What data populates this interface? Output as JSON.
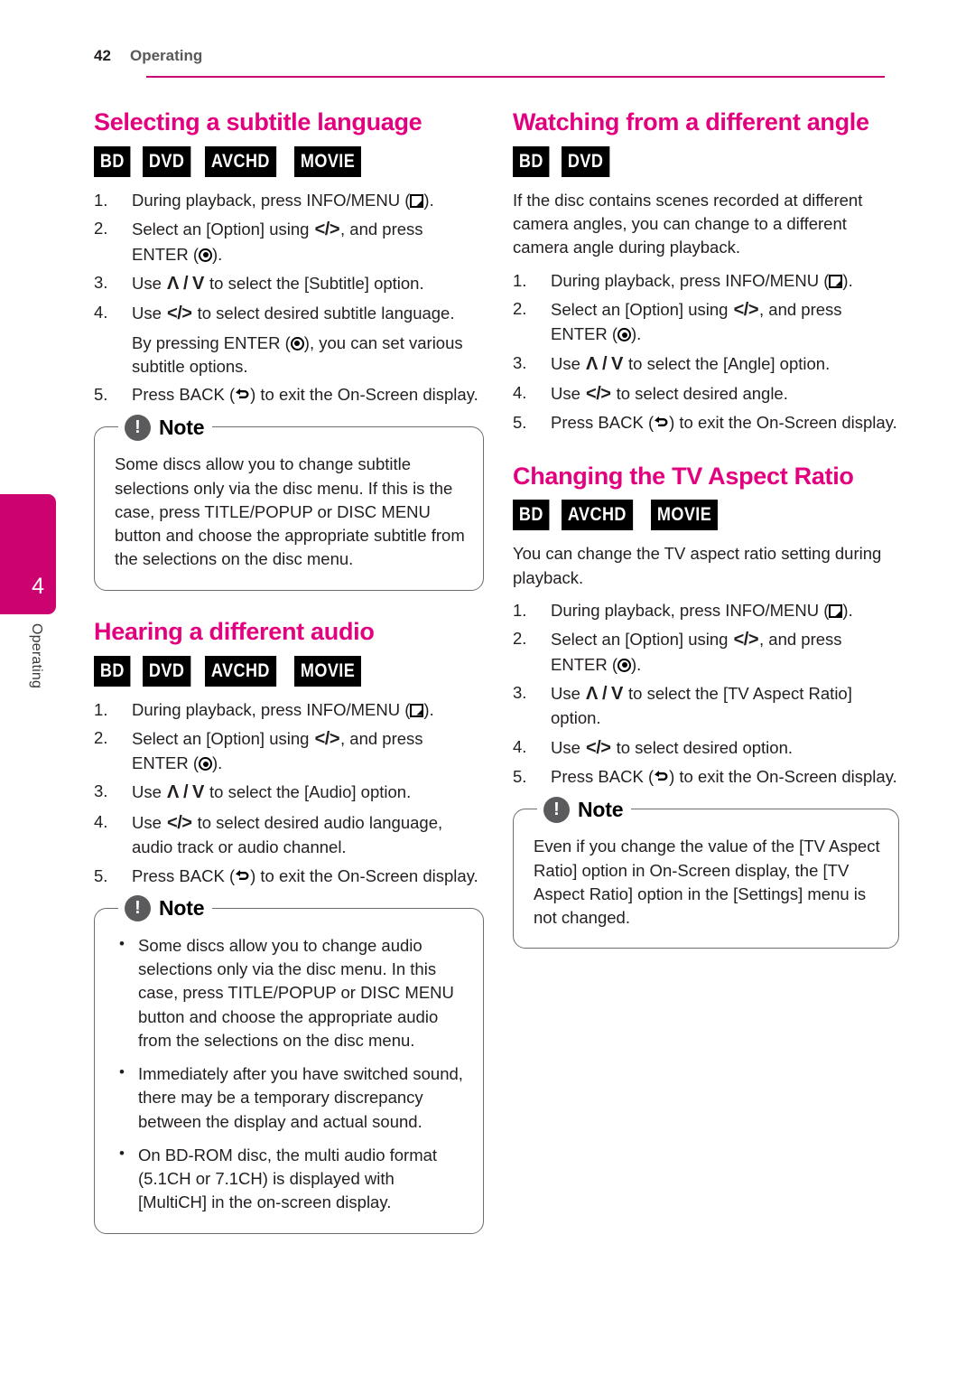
{
  "header": {
    "page_number": "42",
    "chapter_name": "Operating",
    "rule_color": "#cc0271"
  },
  "side_tab": {
    "number": "4",
    "label": "Operating",
    "color": "#cc0271"
  },
  "icons": {
    "info_menu": "info-menu-icon",
    "enter": "enter-icon",
    "back": "back-icon",
    "left_right": "</>",
    "up_down": "Λ / V",
    "note_bang": "!"
  },
  "left_column": {
    "sections": [
      {
        "title": "Selecting a subtitle language",
        "badges": [
          "BD",
          "DVD",
          "AVCHD",
          "MOVIE"
        ],
        "steps": [
          {
            "marker": "1.",
            "pre": "During playback, press INFO/MENU (",
            "glyph": "info",
            "post": ")."
          },
          {
            "marker": "2.",
            "pre": "Select an [Option] using ",
            "glyph": "lr",
            "mid": ", and press ENTER (",
            "glyph2": "enter",
            "post": ")."
          },
          {
            "marker": "3.",
            "pre": "Use ",
            "glyph": "ud",
            "post": " to select the [Subtitle] option."
          },
          {
            "marker": "4.",
            "pre": "Use ",
            "glyph": "lr",
            "post": " to select desired subtitle language.",
            "sub_pre": "By pressing ENTER (",
            "sub_glyph": "enter",
            "sub_post": "), you can set various subtitle options."
          },
          {
            "marker": "5.",
            "pre": "Press BACK (",
            "glyph": "back",
            "post": ") to exit the On-Screen display."
          }
        ],
        "note": {
          "title": "Note",
          "paragraph": "Some discs allow you to change subtitle selections only via the disc menu. If this is the case, press TITLE/POPUP or DISC MENU button and choose the appropriate subtitle from the selections on the disc menu."
        }
      },
      {
        "title": "Hearing a different audio",
        "badges": [
          "BD",
          "DVD",
          "AVCHD",
          "MOVIE"
        ],
        "steps": [
          {
            "marker": "1.",
            "pre": "During playback, press INFO/MENU (",
            "glyph": "info",
            "post": ")."
          },
          {
            "marker": "2.",
            "pre": "Select an [Option] using ",
            "glyph": "lr",
            "mid": ", and press ENTER (",
            "glyph2": "enter",
            "post": ")."
          },
          {
            "marker": "3.",
            "pre": "Use ",
            "glyph": "ud",
            "post": " to select the [Audio] option."
          },
          {
            "marker": "4.",
            "pre": "Use ",
            "glyph": "lr",
            "post": " to select desired audio language, audio track or audio channel."
          },
          {
            "marker": "5.",
            "pre": "Press BACK (",
            "glyph": "back",
            "post": ") to exit the On-Screen display."
          }
        ],
        "note": {
          "title": "Note",
          "bullets": [
            "Some discs allow you to change audio selections only via the disc menu. In this case, press TITLE/POPUP or DISC MENU button and choose the appropriate audio from the selections on the disc menu.",
            "Immediately after you have switched sound, there may be a temporary discrepancy between the display and actual sound.",
            "On BD-ROM disc, the multi audio format (5.1CH or 7.1CH) is displayed with [MultiCH] in the on-screen display."
          ]
        }
      }
    ]
  },
  "right_column": {
    "sections": [
      {
        "title": "Watching from a different angle",
        "badges": [
          "BD",
          "DVD"
        ],
        "intro": "If the disc contains scenes recorded at different camera angles, you can change to a different camera angle during playback.",
        "steps": [
          {
            "marker": "1.",
            "pre": "During playback, press INFO/MENU (",
            "glyph": "info",
            "post": ")."
          },
          {
            "marker": "2.",
            "pre": "Select an [Option] using ",
            "glyph": "lr",
            "mid": ", and press ENTER (",
            "glyph2": "enter",
            "post": ")."
          },
          {
            "marker": "3.",
            "pre": "Use ",
            "glyph": "ud",
            "post": " to select the [Angle] option."
          },
          {
            "marker": "4.",
            "pre": "Use ",
            "glyph": "lr",
            "post": " to select desired angle."
          },
          {
            "marker": "5.",
            "pre": "Press BACK (",
            "glyph": "back",
            "post": ") to exit the On-Screen display."
          }
        ]
      },
      {
        "title": "Changing the TV Aspect Ratio",
        "badges": [
          "BD",
          "AVCHD",
          "MOVIE"
        ],
        "intro": "You can change the TV aspect ratio setting during playback.",
        "steps": [
          {
            "marker": "1.",
            "pre": "During playback, press INFO/MENU (",
            "glyph": "info",
            "post": ")."
          },
          {
            "marker": "2.",
            "pre": "Select an [Option] using ",
            "glyph": "lr",
            "mid": ", and press ENTER (",
            "glyph2": "enter",
            "post": ")."
          },
          {
            "marker": "3.",
            "pre": "Use ",
            "glyph": "ud",
            "post": " to select the [TV Aspect Ratio] option."
          },
          {
            "marker": "4.",
            "pre": "Use ",
            "glyph": "lr",
            "post": " to select desired option."
          },
          {
            "marker": "5.",
            "pre": "Press BACK (",
            "glyph": "back",
            "post": ") to exit the On-Screen display."
          }
        ],
        "note": {
          "title": "Note",
          "paragraph": "Even if you change the value of the [TV Aspect Ratio] option in On-Screen display, the [TV Aspect Ratio] option in the [Settings] menu is not changed."
        }
      }
    ]
  }
}
